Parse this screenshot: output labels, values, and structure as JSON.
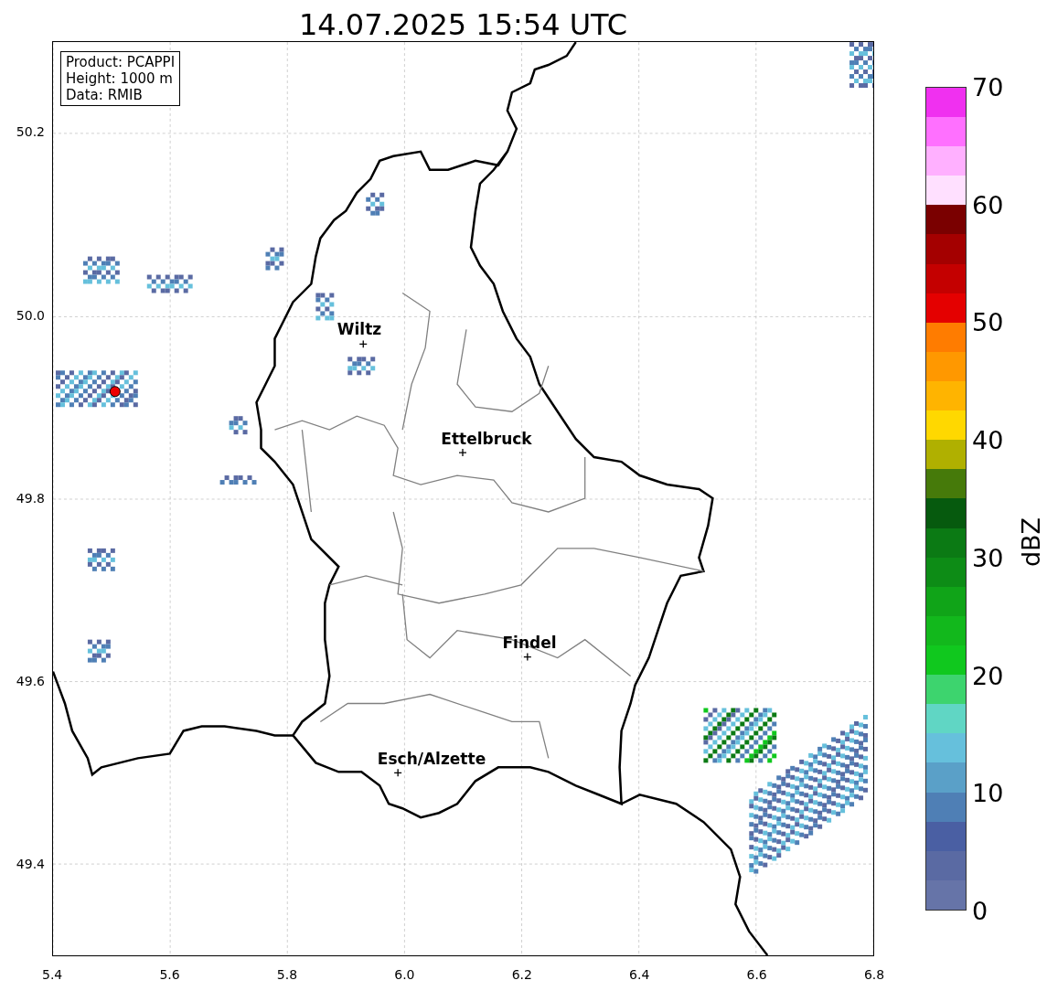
{
  "title": "14.07.2025 15:54 UTC",
  "info_box": [
    "Product: PCAPPI",
    "Height: 1000 m",
    "Data: RMIB"
  ],
  "map": {
    "x_ticks": [
      "5.4",
      "5.6",
      "5.8",
      "6.0",
      "6.2",
      "6.4",
      "6.6",
      "6.8"
    ],
    "y_ticks": [
      "50.2",
      "50.0",
      "49.8",
      "49.6",
      "49.4"
    ],
    "places": [
      {
        "name": "Wiltz"
      },
      {
        "name": "Ettelbruck"
      },
      {
        "name": "Findel"
      },
      {
        "name": "Esch/Alzette"
      }
    ]
  },
  "colorbar": {
    "label": "dBZ",
    "ticks": [
      "70",
      "60",
      "50",
      "40",
      "30",
      "20",
      "10",
      "0"
    ],
    "bands": [
      {
        "color": "#6674a8"
      },
      {
        "color": "#5a6aa3"
      },
      {
        "color": "#4a5fa3"
      },
      {
        "color": "#4f7fb5"
      },
      {
        "color": "#5aa0c8"
      },
      {
        "color": "#66c0dc"
      },
      {
        "color": "#60d6c4"
      },
      {
        "color": "#3dd46e"
      },
      {
        "color": "#10c81e"
      },
      {
        "color": "#12b81c"
      },
      {
        "color": "#10a418"
      },
      {
        "color": "#0d8c16"
      },
      {
        "color": "#0b7a14"
      },
      {
        "color": "#065a0e"
      },
      {
        "color": "#467a0a"
      },
      {
        "color": "#b0b000"
      },
      {
        "color": "#ffd800"
      },
      {
        "color": "#ffb400"
      },
      {
        "color": "#ff9800"
      },
      {
        "color": "#ff7c00"
      },
      {
        "color": "#e40000"
      },
      {
        "color": "#c40000"
      },
      {
        "color": "#a40000"
      },
      {
        "color": "#7a0000"
      },
      {
        "color": "#ffe0ff"
      },
      {
        "color": "#ffb0ff"
      },
      {
        "color": "#ff70ff"
      },
      {
        "color": "#f030f0"
      }
    ]
  }
}
